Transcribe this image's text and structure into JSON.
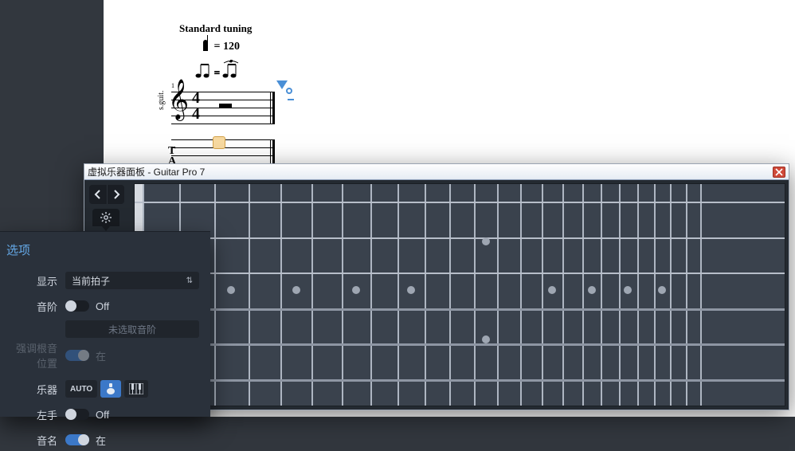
{
  "score": {
    "tuning_label": "Standard tuning",
    "tempo_text": "= 120",
    "track_label": "s.guit.",
    "tab_letters": "T\nA\nB"
  },
  "inst_panel": {
    "title": "虚拟乐器面板 - Guitar Pro 7"
  },
  "options": {
    "title": "选项",
    "display_label": "显示",
    "display_value": "当前拍子",
    "scale_label": "音阶",
    "scale_state": "Off",
    "scale_placeholder": "未选取音阶",
    "root_label": "强调根音位置",
    "root_state": "在",
    "instrument_label": "乐器",
    "instr_auto": "AUTO",
    "left_hand_label": "左手",
    "left_hand_state": "Off",
    "note_name_label": "音名",
    "note_name_state": "在"
  }
}
